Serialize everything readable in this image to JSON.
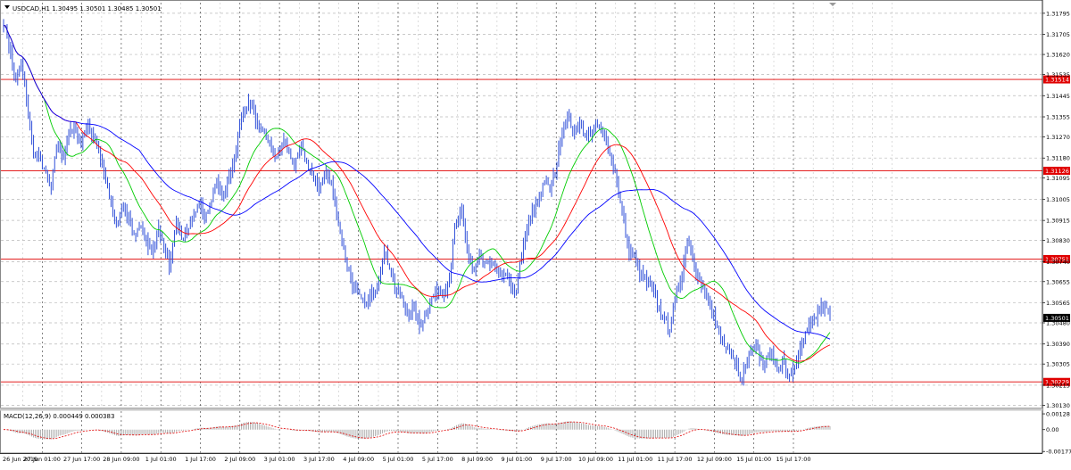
{
  "chart_data": [
    {
      "type": "candlestick",
      "symbol_header": "USDCAD,H1  1.30495 1.30501 1.30485 1.30501",
      "ylim": [
        1.3012,
        1.3184
      ],
      "y_ticks": [
        "1.31795",
        "1.31705",
        "1.31620",
        "1.31535",
        "1.31445",
        "1.31355",
        "1.31270",
        "1.31180",
        "1.31095",
        "1.31005",
        "1.30915",
        "1.30830",
        "1.30740",
        "1.30655",
        "1.30565",
        "1.30480",
        "1.30390",
        "1.30305",
        "1.30215",
        "1.30130"
      ],
      "x_labels": [
        "26 Jun 2019",
        "27 Jun 01:00",
        "27 Jun 17:00",
        "28 Jun 09:00",
        "1 Jul 01:00",
        "1 Jul 17:00",
        "2 Jul 09:00",
        "3 Jul 01:00",
        "3 Jul 17:00",
        "4 Jul 09:00",
        "5 Jul 01:00",
        "5 Jul 17:00",
        "8 Jul 09:00",
        "9 Jul 01:00",
        "9 Jul 17:00",
        "10 Jul 09:00",
        "11 Jul 01:00",
        "11 Jul 17:00",
        "12 Jul 09:00",
        "15 Jul 01:00",
        "15 Jul 17:00"
      ],
      "horizontal_levels": [
        "1.31514",
        "1.31126",
        "1.30751",
        "1.30229"
      ],
      "current_price": "1.30501",
      "close_path": [
        1.3176,
        1.3165,
        1.315,
        1.3158,
        1.314,
        1.312,
        1.3118,
        1.3112,
        1.3105,
        1.3125,
        1.3118,
        1.3128,
        1.313,
        1.3124,
        1.3132,
        1.3128,
        1.312,
        1.3112,
        1.31,
        1.3088,
        1.3098,
        1.3092,
        1.3085,
        1.309,
        1.3082,
        1.3078,
        1.3088,
        1.308,
        1.3072,
        1.309,
        1.3084,
        1.3089,
        1.3094,
        1.3098,
        1.3092,
        1.3102,
        1.3108,
        1.31,
        1.3112,
        1.312,
        1.3135,
        1.3142,
        1.3138,
        1.313,
        1.3128,
        1.3122,
        1.3118,
        1.3126,
        1.312,
        1.3115,
        1.3122,
        1.3116,
        1.311,
        1.3105,
        1.3112,
        1.3108,
        1.3096,
        1.3082,
        1.307,
        1.3062,
        1.3058,
        1.3056,
        1.306,
        1.3066,
        1.3078,
        1.3072,
        1.3062,
        1.3058,
        1.305,
        1.3055,
        1.3046,
        1.3052,
        1.3058,
        1.3062,
        1.306,
        1.3068,
        1.309,
        1.3095,
        1.3078,
        1.307,
        1.3076,
        1.3072,
        1.3074,
        1.307,
        1.3068,
        1.3066,
        1.306,
        1.3074,
        1.3088,
        1.3095,
        1.3102,
        1.3108,
        1.3104,
        1.3116,
        1.313,
        1.3135,
        1.3128,
        1.3134,
        1.3126,
        1.313,
        1.3132,
        1.3128,
        1.312,
        1.311,
        1.3095,
        1.308,
        1.3076,
        1.307,
        1.3066,
        1.3062,
        1.3056,
        1.305,
        1.3045,
        1.3058,
        1.3068,
        1.3085,
        1.3074,
        1.3066,
        1.306,
        1.3054,
        1.3045,
        1.304,
        1.3036,
        1.3032,
        1.3025,
        1.3032,
        1.304,
        1.3034,
        1.303,
        1.3037,
        1.3028,
        1.3032,
        1.3024,
        1.303,
        1.3036,
        1.3044,
        1.3048,
        1.3052,
        1.3056,
        1.305
      ],
      "moving_averages": [
        {
          "color": "#00cc00",
          "period": 8
        },
        {
          "color": "#ff0000",
          "period": 14
        },
        {
          "color": "#0000ff",
          "period": 26
        }
      ]
    },
    {
      "type": "macd",
      "label": "MACD(12,26,9) 0.000449 0.000383",
      "ylim": [
        -0.0019,
        0.0015
      ],
      "y_ticks": [
        "0.00128",
        "0.00",
        "-0.00177"
      ]
    }
  ],
  "colors": {
    "candle": "#3050d8",
    "level_line": "#e00000",
    "level_label_bg": "#e00000",
    "current_label_bg": "#000000",
    "grid": "#b8b8b8",
    "border": "#888888",
    "macd_hist": "#a0a0a0",
    "macd_signal": "#e00000"
  }
}
